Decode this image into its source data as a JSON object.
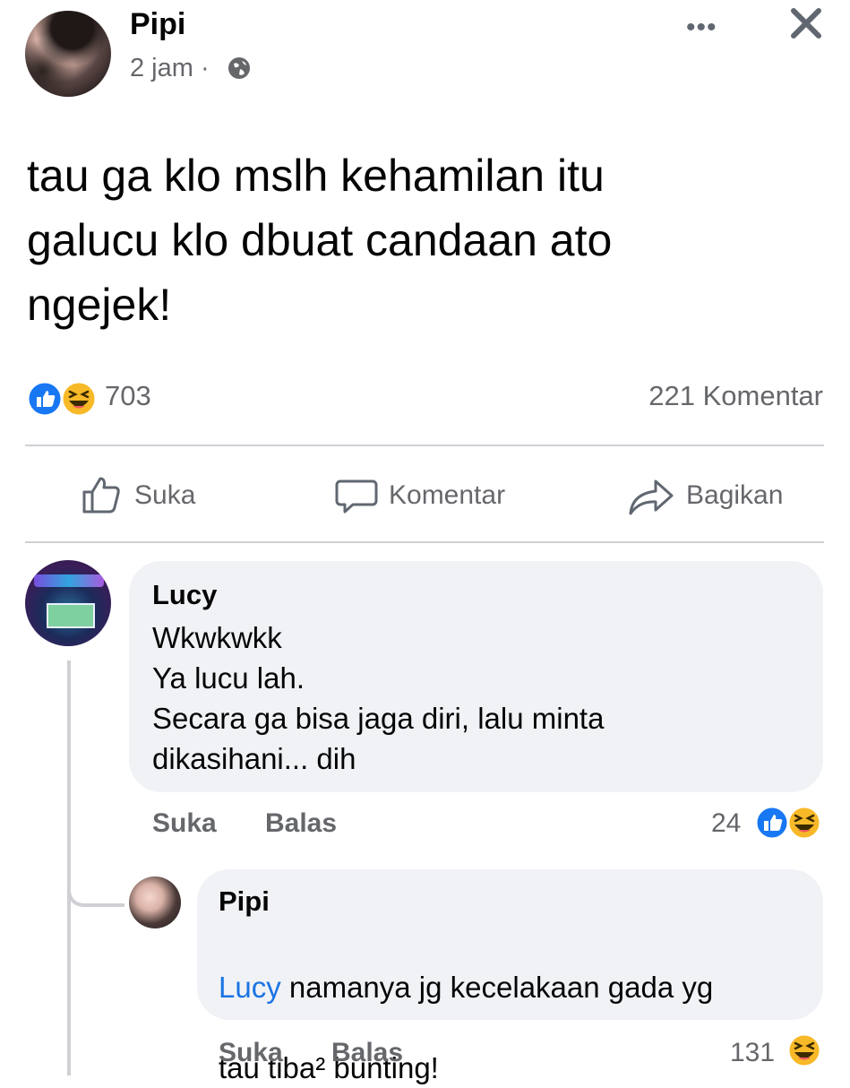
{
  "post": {
    "author": "Pipi",
    "time": "2 jam ·",
    "text": "tau ga klo mslh kehamilan itu\ngalucu klo dbuat candaan ato\nngejek!",
    "more_icon": "more-dots-icon",
    "close_icon": "close-icon",
    "privacy_icon": "globe-icon"
  },
  "reactions": {
    "count": "703",
    "comments_label": "221 Komentar",
    "types": [
      "like",
      "haha"
    ]
  },
  "actions": {
    "like_label": "Suka",
    "comment_label": "Komentar",
    "share_label": "Bagikan"
  },
  "comments": [
    {
      "author": "Lucy",
      "text": "Wkwkwkk\nYa lucu lah.\nSecara ga bisa jaga diri, lalu minta\ndikasihani... dih",
      "like_label": "Suka",
      "reply_label": "Balas",
      "reaction_count": "24",
      "reaction_types": [
        "like",
        "haha"
      ]
    }
  ],
  "replies": [
    {
      "author": "Pipi",
      "mention": "Lucy",
      "text_line1": " namanya jg kecelakaan gada yg",
      "text_line2": "tau tiba² bunting!",
      "like_label": "Suka",
      "reply_label": "Balas",
      "reaction_count": "131",
      "reaction_types": [
        "haha"
      ]
    }
  ],
  "colors": {
    "like_blue": "#1877f2",
    "haha_yellow": "#f7b928",
    "mention_blue": "#1b74e4",
    "muted_text": "#65676b",
    "bubble_bg": "#f0f2f5"
  }
}
